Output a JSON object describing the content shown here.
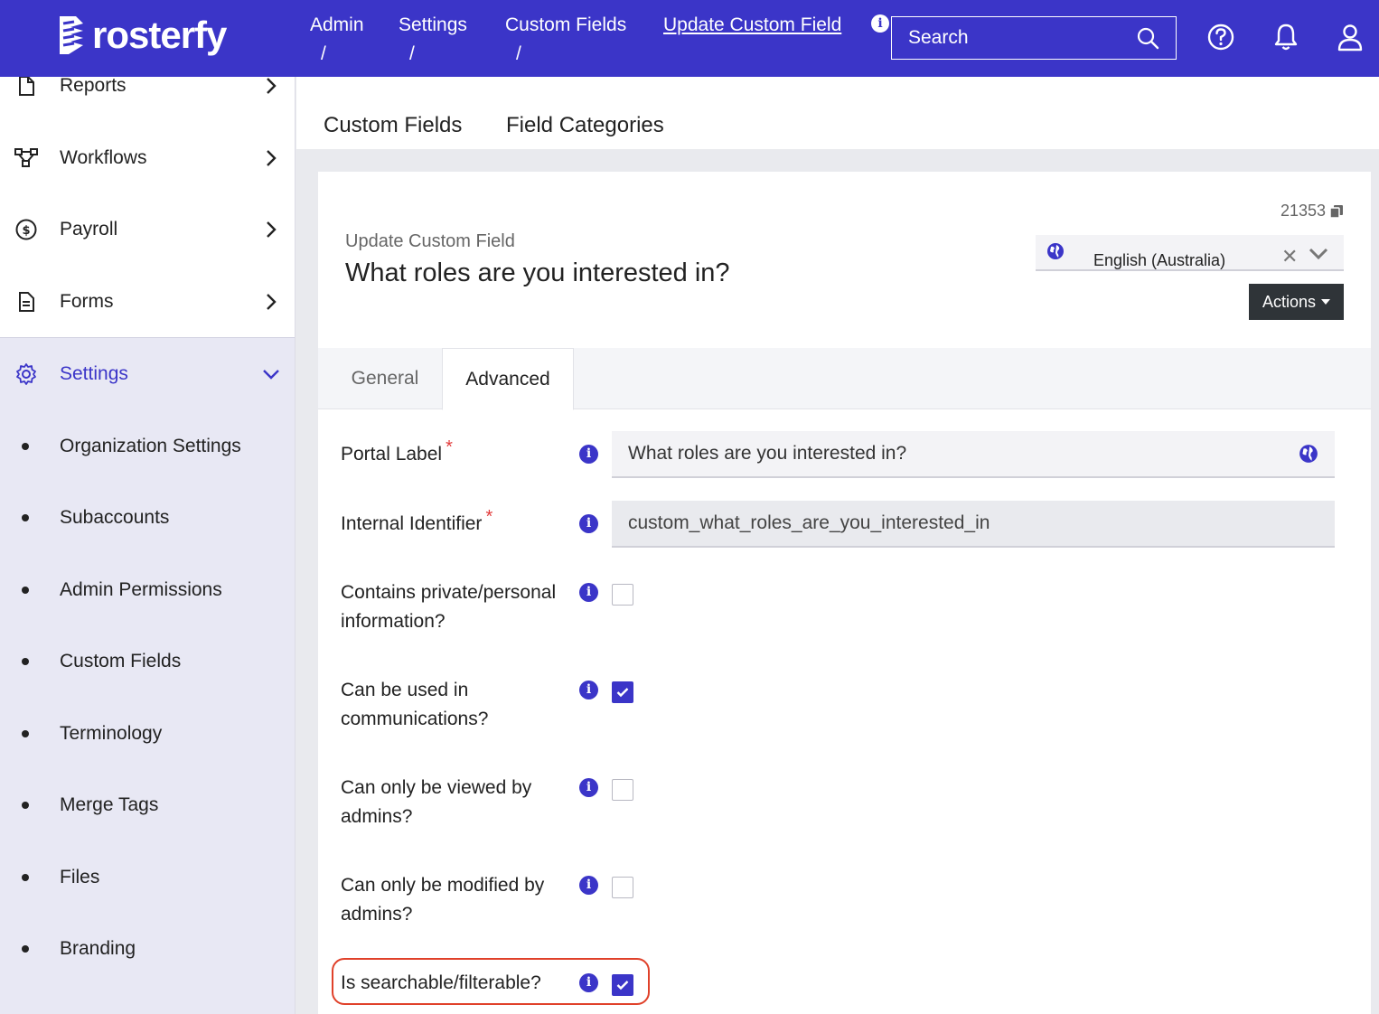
{
  "app": {
    "brand": "rosterfy",
    "accent": "#3b35c8"
  },
  "breadcrumbs": [
    {
      "label": "Admin",
      "sep": "/"
    },
    {
      "label": "Settings",
      "sep": "/"
    },
    {
      "label": "Custom Fields",
      "sep": "/"
    },
    {
      "label": "Update Custom Field"
    }
  ],
  "search": {
    "placeholder": "Search"
  },
  "header_icons": [
    "info-icon",
    "search-icon",
    "help-icon",
    "bell-icon",
    "user-icon"
  ],
  "sidebar": {
    "items": [
      {
        "label": "Reports",
        "icon": "file-icon"
      },
      {
        "label": "Workflows",
        "icon": "workflow-icon"
      },
      {
        "label": "Payroll",
        "icon": "dollar-icon"
      },
      {
        "label": "Forms",
        "icon": "form-icon"
      }
    ],
    "settings": {
      "label": "Settings",
      "icon": "gear-icon",
      "children": [
        "Organization Settings",
        "Subaccounts",
        "Admin Permissions",
        "Custom Fields",
        "Terminology",
        "Merge Tags",
        "Files",
        "Branding"
      ]
    }
  },
  "page_tabs": [
    "Custom Fields",
    "Field Categories"
  ],
  "card": {
    "record_id": "21353",
    "subtitle": "Update Custom Field",
    "title": "What roles are you interested in?",
    "language": "English (Australia)",
    "actions_label": "Actions",
    "tabs": [
      "General",
      "Advanced"
    ],
    "active_tab": "Advanced"
  },
  "form": {
    "portal_label": {
      "label": "Portal Label",
      "value": "What roles are you interested in?",
      "required_mark": "*"
    },
    "internal_identifier": {
      "label": "Internal Identifier",
      "value": "custom_what_roles_are_you_interested_in",
      "required_mark": "*"
    },
    "checkboxes": [
      {
        "label": "Contains private/personal information?",
        "checked": false
      },
      {
        "label": "Can be used in communications?",
        "checked": true
      },
      {
        "label": "Can only be viewed by admins?",
        "checked": false
      },
      {
        "label": "Can only be modified by admins?",
        "checked": false
      },
      {
        "label": "Is searchable/filterable?",
        "checked": true
      }
    ],
    "info_glyph": "i"
  }
}
